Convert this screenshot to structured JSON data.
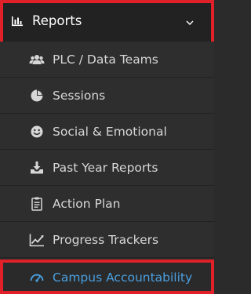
{
  "header": {
    "title": "Reports",
    "icon": "bar-chart-icon"
  },
  "items": [
    {
      "label": "PLC / Data Teams",
      "icon": "users-icon"
    },
    {
      "label": "Sessions",
      "icon": "pie-chart-icon"
    },
    {
      "label": "Social & Emotional",
      "icon": "smile-icon"
    },
    {
      "label": "Past Year Reports",
      "icon": "download-tray-icon"
    },
    {
      "label": "Action Plan",
      "icon": "clipboard-icon"
    },
    {
      "label": "Progress Trackers",
      "icon": "line-chart-icon"
    },
    {
      "label": "Campus Accountability",
      "icon": "gauge-icon",
      "active": true
    }
  ],
  "colors": {
    "highlight_border": "#e0212a",
    "active_text": "#4a9fe0",
    "item_text": "#d7d7d7",
    "background": "#2b2b2b"
  }
}
